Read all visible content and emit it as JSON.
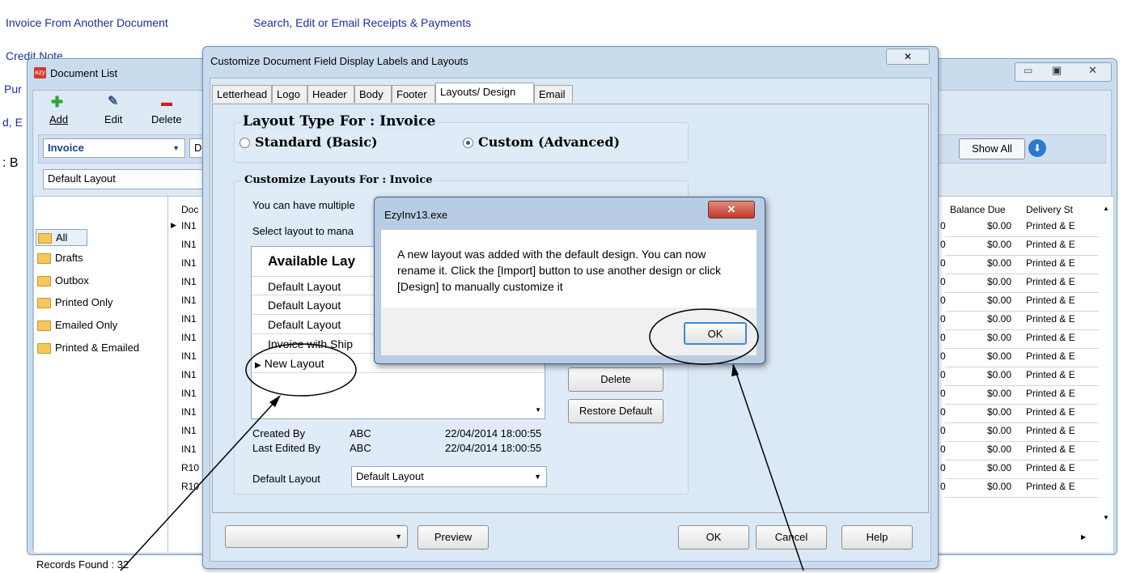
{
  "background": {
    "link_invoice_from_doc": "Invoice From Another Document",
    "link_search_receipts": "Search, Edit or Email Receipts & Payments",
    "link_credit_note": "Credit Note",
    "frag_pur": "Pur",
    "frag_de": "d, E",
    "frag_b": ": B"
  },
  "doc_list": {
    "title": "Document List",
    "toolbar": {
      "add": "Add",
      "edit": "Edit",
      "delete": "Delete"
    },
    "doc_type_value": "Invoice",
    "layout_value": "Default Layout",
    "show_all": "Show All",
    "folders": [
      "All",
      "Drafts",
      "Outbox",
      "Printed Only",
      "Emailed Only",
      "Printed & Emailed"
    ],
    "grid": {
      "col_doc": "Doc",
      "col_balance": "Balance Due",
      "col_delivery": "Delivery St",
      "doc_rows": [
        "IN1",
        "IN1",
        "IN1",
        "IN1",
        "IN1",
        "IN1",
        "IN1",
        "IN1",
        "IN1",
        "IN1",
        "IN1",
        "IN1",
        "IN1",
        "R10",
        "R10"
      ],
      "balance_rows": [
        "$0.00",
        "$0.00",
        "$0.00",
        "$0.00",
        "$0.00",
        "$0.00",
        "$0.00",
        "$0.00",
        "$0.00",
        "$0.00",
        "$0.00",
        "$0.00",
        "$0.00",
        "$0.00",
        "$0.00"
      ],
      "delivery_rows": [
        "Printed & E",
        "Printed & E",
        "Printed & E",
        "Printed & E",
        "Printed & E",
        "Printed & E",
        "Printed & E",
        "Printed & E",
        "Printed & E",
        "Printed & E",
        "Printed & E",
        "Printed & E",
        "Printed & E",
        "Printed & E",
        "Printed & E"
      ],
      "left_col_rows": [
        "0",
        "0",
        "0",
        "0",
        "0",
        "0",
        "0",
        "0",
        "0",
        "0",
        "0",
        "0",
        "0",
        "0",
        "0"
      ]
    },
    "records_found": "Records Found : 32"
  },
  "customize_dialog": {
    "title": "Customize Document Field Display Labels and Layouts",
    "tabs": [
      "Letterhead",
      "Logo",
      "Header",
      "Body",
      "Footer",
      "Layouts/ Design",
      "Email"
    ],
    "layout_type_heading": "Layout Type For : Invoice",
    "radio_standard": "Standard (Basic)",
    "radio_custom": "Custom (Advanced)",
    "customize_heading": "Customize Layouts For : Invoice",
    "info_line1": "You can have multiple",
    "info_line2": "Select layout to mana",
    "list_header": "Available Lay",
    "layouts": [
      "Default Layout",
      "Default Layout",
      "Default Layout",
      "Invoice with Ship",
      "New Layout"
    ],
    "btn_delete": "Delete",
    "btn_restore": "Restore Default",
    "created_by_label": "Created By",
    "created_by_value": "ABC",
    "created_date": "22/04/2014 18:00:55",
    "edited_by_label": "Last Edited By",
    "edited_by_value": "ABC",
    "edited_date": "22/04/2014 18:00:55",
    "default_layout_label": "Default Layout",
    "default_layout_value": "Default Layout",
    "btn_preview": "Preview",
    "btn_ok": "OK",
    "btn_cancel": "Cancel",
    "btn_help": "Help"
  },
  "message_box": {
    "title": "EzyInv13.exe",
    "text": "A new layout was added with the default design. You can now rename it. Click the [Import] button to use another design or click [Design] to manually customize it",
    "ok": "OK"
  }
}
